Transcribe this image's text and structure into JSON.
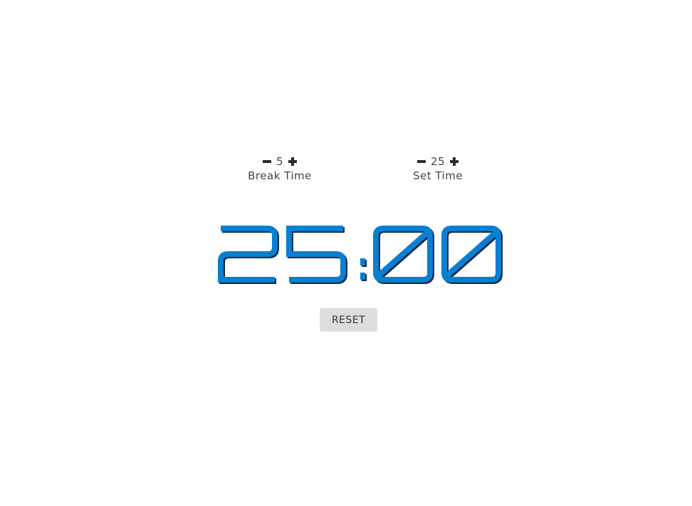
{
  "break": {
    "value": "5",
    "label": "Break Time"
  },
  "session": {
    "value": "25",
    "label": "Set Time"
  },
  "timer": {
    "display": "25:00",
    "color": "#0a7fd1",
    "shadow_color": "#0b2a4a"
  },
  "reset": {
    "label": "RESET"
  }
}
